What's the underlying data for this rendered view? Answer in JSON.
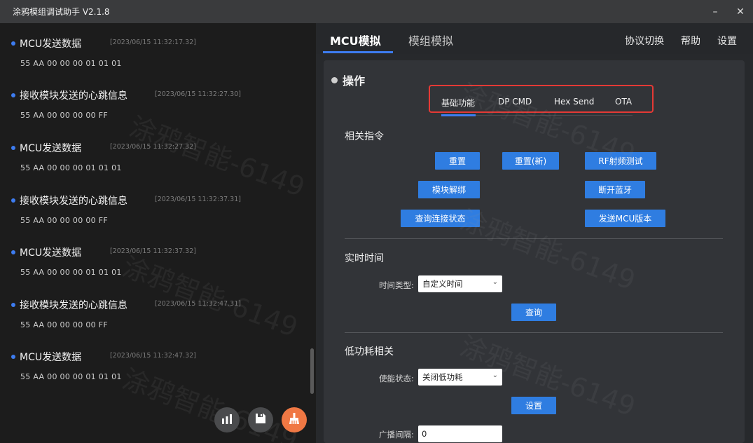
{
  "window": {
    "title": "涂鸦模组调试助手 V2.1.8",
    "minimize_label": "–",
    "close_label": "✕"
  },
  "log": {
    "entries": [
      {
        "title": "MCU发送数据",
        "time": "[2023/06/15 11:32:17.32]",
        "data": "55 AA 00 00 00 01 01 01"
      },
      {
        "title": "接收模块发送的心跳信息",
        "time": "[2023/06/15 11:32:27.30]",
        "data": "55 AA 00 00 00 00 FF"
      },
      {
        "title": "MCU发送数据",
        "time": "[2023/06/15 11:32:27.32]",
        "data": "55 AA 00 00 00 01 01 01"
      },
      {
        "title": "接收模块发送的心跳信息",
        "time": "[2023/06/15 11:32:37.31]",
        "data": "55 AA 00 00 00 00 FF"
      },
      {
        "title": "MCU发送数据",
        "time": "[2023/06/15 11:32:37.32]",
        "data": "55 AA 00 00 00 01 01 01"
      },
      {
        "title": "接收模块发送的心跳信息",
        "time": "[2023/06/15 11:32:47.31]",
        "data": "55 AA 00 00 00 00 FF"
      },
      {
        "title": "MCU发送数据",
        "time": "[2023/06/15 11:32:47.32]",
        "data": "55 AA 00 00 00 01 01 01"
      }
    ],
    "actions": [
      "chart-icon",
      "save-icon",
      "clean-brush-icon"
    ]
  },
  "tabs": {
    "mcu": "MCU模拟",
    "module": "模组模拟"
  },
  "menu": {
    "protocol": "协议切换",
    "help": "帮助",
    "settings": "设置"
  },
  "operation": {
    "title": "操作",
    "subtabs": [
      "基础功能",
      "DP CMD",
      "Hex Send",
      "OTA"
    ]
  },
  "commands": {
    "title": "相关指令",
    "reset": "重置",
    "reset_new": "重置(新)",
    "rf_test": "RF射频测试",
    "unbind": "模块解绑",
    "disconnect_bt": "断开蓝牙",
    "query_status": "查询连接状态",
    "send_mcu_version": "发送MCU版本"
  },
  "realtime": {
    "title": "实时时间",
    "type_label": "时间类型:",
    "type_value": "自定义时间",
    "query": "查询"
  },
  "low_power": {
    "title": "低功耗相关",
    "state_label": "使能状态:",
    "state_value": "关闭低功耗",
    "set": "设置",
    "interval_label": "广播间隔:",
    "interval_value": "0"
  },
  "watermark": "涂鸦智能-6149",
  "colors": {
    "accent": "#3d7cf0",
    "button": "#2f7de1",
    "highlight_box": "#e53935",
    "clean_button": "#f07844"
  }
}
